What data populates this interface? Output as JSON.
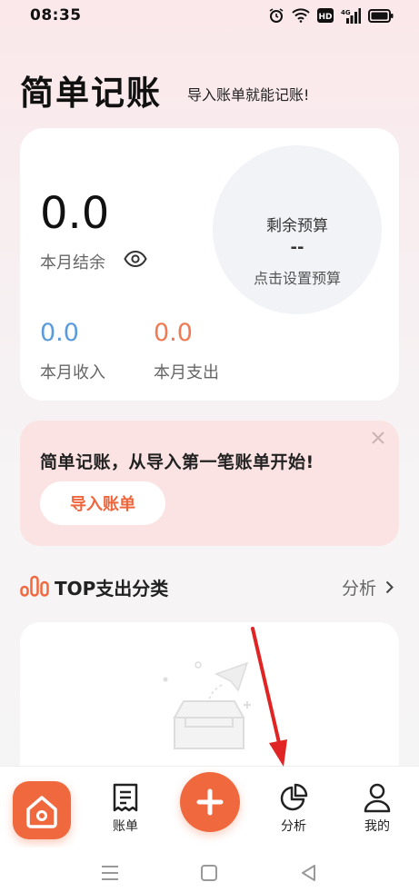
{
  "status_bar": {
    "time": "08:35",
    "network": "4G"
  },
  "header": {
    "title": "简单记账",
    "subtitle": "导入账单就能记账!"
  },
  "summary": {
    "balance": "0.0",
    "balance_label": "本月结余",
    "budget_title": "剩余预算",
    "budget_value": "--",
    "budget_hint": "点击设置预算",
    "income": "0.0",
    "income_label": "本月收入",
    "expense": "0.0",
    "expense_label": "本月支出"
  },
  "promo": {
    "text": "简单记账，从导入第一笔账单开始!",
    "button": "导入账单"
  },
  "top_section": {
    "title": "TOP支出分类",
    "link": "分析"
  },
  "tabs": [
    {
      "label": "账单",
      "icon": "bill-icon"
    },
    {
      "label": "分析",
      "icon": "pie-chart-icon"
    },
    {
      "label": "我的",
      "icon": "user-icon"
    }
  ],
  "colors": {
    "accent": "#f0693e",
    "income": "#5b9bdc",
    "expense": "#f07a53"
  }
}
